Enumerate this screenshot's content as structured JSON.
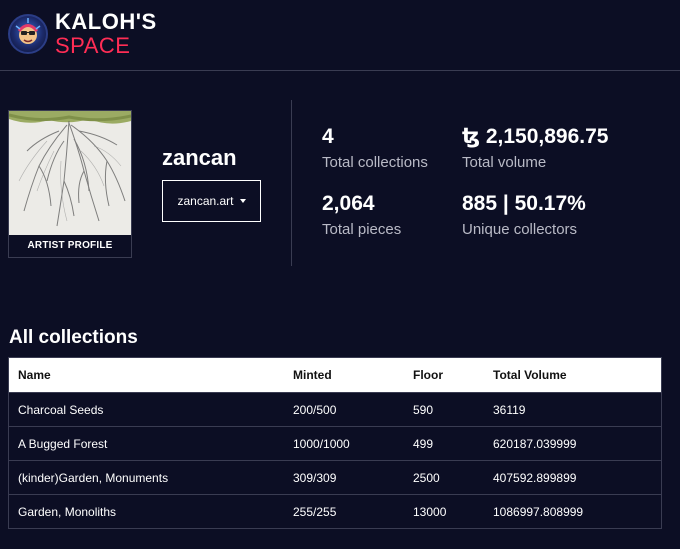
{
  "header": {
    "logo_line1": "KALOH'S",
    "logo_line2": "SPACE"
  },
  "artist": {
    "name": "zancan",
    "profile_label": "ARTIST PROFILE",
    "link_label": "zancan.art"
  },
  "stats": [
    {
      "value": "4",
      "label": "Total collections"
    },
    {
      "value": "ꜩ 2,150,896.75",
      "label": "Total volume"
    },
    {
      "value": "2,064",
      "label": "Total pieces"
    },
    {
      "value": "885 | 50.17%",
      "label": "Unique collectors"
    }
  ],
  "collections": {
    "title": "All collections",
    "columns": [
      "Name",
      "Minted",
      "Floor",
      "Total Volume"
    ],
    "rows": [
      {
        "name": "Charcoal Seeds",
        "minted": "200/500",
        "floor": "590",
        "volume": "36119"
      },
      {
        "name": "A Bugged Forest",
        "minted": "1000/1000",
        "floor": "499",
        "volume": "620187.039999"
      },
      {
        "name": "(kinder)Garden, Monuments",
        "minted": "309/309",
        "floor": "2500",
        "volume": "407592.899899"
      },
      {
        "name": "Garden, Monoliths",
        "minted": "255/255",
        "floor": "13000",
        "volume": "1086997.808999"
      }
    ]
  },
  "colors": {
    "background": "#0c0e24",
    "accent": "#ff2d55",
    "divider": "#3a3c52"
  }
}
